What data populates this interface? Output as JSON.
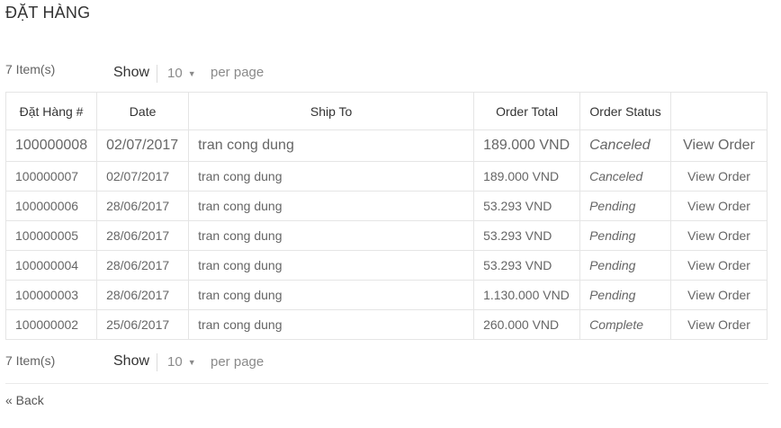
{
  "page": {
    "title": "ĐẶT HÀNG"
  },
  "toolbar_top": {
    "count": "7 Item(s)",
    "show": "Show",
    "limit": "10",
    "per_page": "per page"
  },
  "toolbar_bottom": {
    "count": "7 Item(s)",
    "show": "Show",
    "limit": "10",
    "per_page": "per page"
  },
  "table": {
    "headers": [
      "Đặt Hàng #",
      "Date",
      "Ship To",
      "Order Total",
      "Order Status",
      ""
    ],
    "rows": [
      {
        "id": "100000008",
        "date": "02/07/2017",
        "ship_to": "tran cong dung",
        "total": "189.000 VND",
        "status": "Canceled",
        "action": "View Order"
      },
      {
        "id": "100000007",
        "date": "02/07/2017",
        "ship_to": "tran cong dung",
        "total": "189.000 VND",
        "status": "Canceled",
        "action": "View Order"
      },
      {
        "id": "100000006",
        "date": "28/06/2017",
        "ship_to": "tran cong dung",
        "total": "53.293 VND",
        "status": "Pending",
        "action": "View Order"
      },
      {
        "id": "100000005",
        "date": "28/06/2017",
        "ship_to": "tran cong dung",
        "total": "53.293 VND",
        "status": "Pending",
        "action": "View Order"
      },
      {
        "id": "100000004",
        "date": "28/06/2017",
        "ship_to": "tran cong dung",
        "total": "53.293 VND",
        "status": "Pending",
        "action": "View Order"
      },
      {
        "id": "100000003",
        "date": "28/06/2017",
        "ship_to": "tran cong dung",
        "total": "1.130.000 VND",
        "status": "Pending",
        "action": "View Order"
      },
      {
        "id": "100000002",
        "date": "25/06/2017",
        "ship_to": "tran cong dung",
        "total": "260.000 VND",
        "status": "Complete",
        "action": "View Order"
      }
    ]
  },
  "back": {
    "label": "« Back"
  },
  "colors": {
    "link": "#1e73be",
    "border": "#e5e5e5",
    "muted": "#8a8a8a"
  }
}
